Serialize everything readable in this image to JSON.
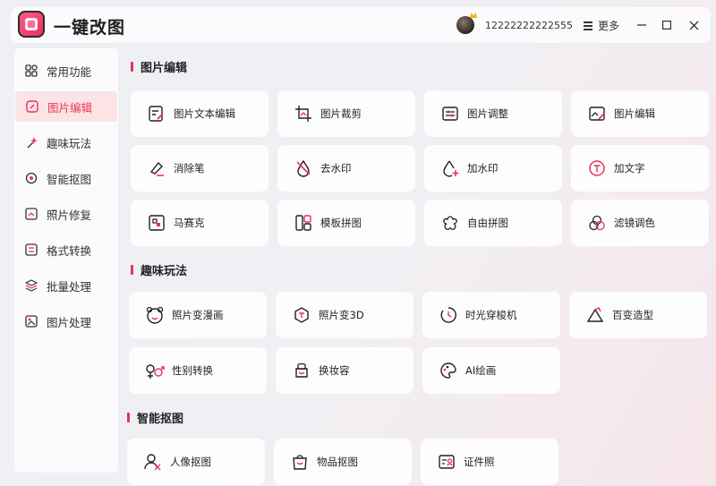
{
  "titlebar": {
    "app_title": "一键改图",
    "user_name": "12222222222555",
    "more_label": "更多"
  },
  "sidebar": {
    "items": [
      {
        "label": "常用功能",
        "icon": "grid-icon"
      },
      {
        "label": "图片编辑",
        "icon": "edit-icon",
        "active": true
      },
      {
        "label": "趣味玩法",
        "icon": "sparkle-icon"
      },
      {
        "label": "智能抠图",
        "icon": "target-icon"
      },
      {
        "label": "照片修复",
        "icon": "photo-repair-icon"
      },
      {
        "label": "格式转换",
        "icon": "format-convert-icon"
      },
      {
        "label": "批量处理",
        "icon": "layers-icon"
      },
      {
        "label": "图片处理",
        "icon": "image-process-icon"
      }
    ]
  },
  "sections": {
    "image_edit": {
      "title": "图片编辑",
      "cards": [
        "图片文本编辑",
        "图片裁剪",
        "图片调整",
        "图片编辑",
        "消除笔",
        "去水印",
        "加水印",
        "加文字",
        "马赛克",
        "模板拼图",
        "自由拼图",
        "滤镜调色"
      ]
    },
    "fun": {
      "title": "趣味玩法",
      "cards": [
        "照片变漫画",
        "照片变3D",
        "时光穿梭机",
        "百变造型",
        "性别转换",
        "换妆容",
        "AI绘画"
      ]
    },
    "smart_cutout": {
      "title": "智能抠图",
      "cards": [
        "人像抠图",
        "物品抠图",
        "证件照"
      ]
    }
  },
  "colors": {
    "accent": "#e8325e",
    "active_bg": "#fbe3e6"
  }
}
